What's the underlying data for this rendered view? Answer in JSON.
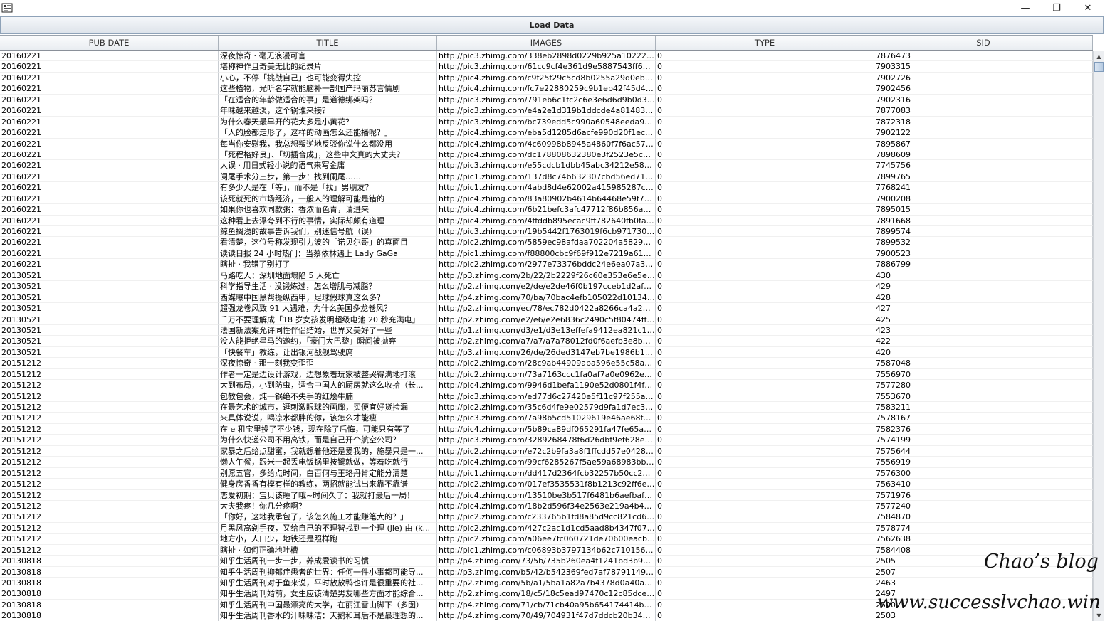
{
  "window": {
    "minimize": "—",
    "maximize": "❐",
    "close": "✕"
  },
  "toolbar": {
    "load_label": "Load Data"
  },
  "table": {
    "columns": [
      "PUB DATE",
      "TITLE",
      "IMAGES",
      "TYPE",
      "SID"
    ],
    "rows": [
      [
        "20160221",
        "深夜惊奇 · 毫无浪漫可言",
        "http://pic3.zhimg.com/338eb2898d0229b925a10222c1...",
        "0",
        "7876473"
      ],
      [
        "20160221",
        "堪称神作且奇美无比的纪录片",
        "http://pic3.zhimg.com/61cc9cf4e361d9e5887543ff6ab0...",
        "0",
        "7903315"
      ],
      [
        "20160221",
        "小心，不停「挑战自己」也可能变得失控",
        "http://pic4.zhimg.com/c9f25f29c5cd8b0255a29d0eb3dc...",
        "0",
        "7902726"
      ],
      [
        "20160221",
        "这些植物，光听名字就能脑补一部国产玛丽苏言情剧",
        "http://pic4.zhimg.com/fc7e22880259c9b1eb42f45d4b9b...",
        "0",
        "7902456"
      ],
      [
        "20160221",
        "「在适合的年龄做适合的事」是道德绑架吗？",
        "http://pic3.zhimg.com/791eb6c1fc2c6e3e6d6d9b0d392...",
        "0",
        "7902316"
      ],
      [
        "20160221",
        "年味越来越淡，这个锅谁来接？",
        "http://pic3.zhimg.com/e4a2e1d319b1ddcde4a81483f4a...",
        "0",
        "7877083"
      ],
      [
        "20160221",
        "为什么春天最早开的花大多是小黄花？",
        "http://pic3.zhimg.com/bc739edd5c990a60548eeda9d7...",
        "0",
        "7872318"
      ],
      [
        "20160221",
        "「人的脸都走形了，这样的动画怎么还能播呢？」",
        "http://pic4.zhimg.com/eba5d1285d6acfe990d20f1ec9b7...",
        "0",
        "7902122"
      ],
      [
        "20160221",
        "每当你安慰我，我总想叛逆地反驳你说什么都没用",
        "http://pic4.zhimg.com/4c60998b8945a4860f7f6ac57c89...",
        "0",
        "7895867"
      ],
      [
        "20160221",
        "「死程格好良」、「切插合成」，这些中文真的大丈夫？",
        "http://pic4.zhimg.com/dc178808632380e3f2523e5cffaf7...",
        "0",
        "7898609"
      ],
      [
        "20160221",
        "大误 · 用日式轻小说的语气来写金庸",
        "http://pic3.zhimg.com/e55cdcb1dbb45abc34212e587b2...",
        "0",
        "7745756"
      ],
      [
        "20160221",
        "阑尾手术分三步，第一步：找到阑尾……",
        "http://pic1.zhimg.com/137d8c74b632307cbd56ed71b8...",
        "0",
        "7899765"
      ],
      [
        "20160221",
        "有多少人是在「等」，而不是「找」男朋友？",
        "http://pic1.zhimg.com/4abd8d4e62002a415985287c6b...",
        "0",
        "7768241"
      ],
      [
        "20160221",
        "该死就死的市场经济，一般人的理解可能是错的",
        "http://pic4.zhimg.com/83a80902b4614b64468e59f7a01...",
        "0",
        "7900208"
      ],
      [
        "20160221",
        "如果你也喜欢同款粥：香浓而色青，请进来",
        "http://pic4.zhimg.com/6b21befc3afc47712f86b856abe4...",
        "0",
        "7895015"
      ],
      [
        "20160221",
        "这种看上去浮夸到不行的事情，实际却颇有道理",
        "http://pic4.zhimg.com/4ffddb895ecac9ff782640fb0fa991...",
        "0",
        "7891668"
      ],
      [
        "20160221",
        "鲸鱼搁浅的故事告诉我们，别迷信号航（误）",
        "http://pic3.zhimg.com/19b5442f1763019f6cb971730ff68...",
        "0",
        "7899574"
      ],
      [
        "20160221",
        "看清楚，这位号称发现引力波的「诺贝尔哥」的真面目",
        "http://pic2.zhimg.com/5859ec98afdaa702204a58291b9...",
        "0",
        "7899532"
      ],
      [
        "20160221",
        "读读日报 24 小时热门：当蔡依林遇上 Lady GaGa",
        "http://pic1.zhimg.com/f88800cbc9f69f912e7219a6186b...",
        "0",
        "7900523"
      ],
      [
        "20160221",
        "瞎扯 · 我错了别打了",
        "http://pic2.zhimg.com/2977e73376bddc24e6ea07a301...",
        "0",
        "7886799"
      ],
      [
        "20130521",
        "马路吃人：深圳地面塌陷 5 人死亡",
        "http://p3.zhimg.com/2b/22/2b2229f26c60e353e6e5efb5...",
        "0",
        "430"
      ],
      [
        "20130521",
        "科学指导生活 · 没锻炼过，怎么增肌与减脂？",
        "http://p2.zhimg.com/e2/de/e2de46f0b197cceb1d2af0d5...",
        "0",
        "429"
      ],
      [
        "20130521",
        "西媒曝中国黑帮操纵西甲，足球假球真这么多？",
        "http://p4.zhimg.com/70/ba/70bac4efb105022d1013494...",
        "0",
        "428"
      ],
      [
        "20130521",
        "超强龙卷风致 91 人遇难，为什么美国多龙卷风？",
        "http://p2.zhimg.com/ec/78/ec782d0422a8266ca4a2d58...",
        "0",
        "427"
      ],
      [
        "20130521",
        "千万不要理解成「18 岁女孩发明超级电池 20 秒充满电」",
        "http://p2.zhimg.com/e2/e6/e2e6836c2490c5f80474ff030...",
        "0",
        "425"
      ],
      [
        "20130521",
        "法国新法案允许同性伴侣结婚，世界又美好了一些",
        "http://p1.zhimg.com/d3/e1/d3e13effefa9412ea821c183...",
        "0",
        "423"
      ],
      [
        "20130521",
        "没人能拒绝星马的邀约，「豪门大巴黎」瞬间被抛弃",
        "http://p2.zhimg.com/a7/a7/a7a78012fd0f6aefb3e8b7e2...",
        "0",
        "422"
      ],
      [
        "20130521",
        "「快餐车」教练，让出银河战舰驾驶席",
        "http://p3.zhimg.com/26/de/26ded3147eb7be1986b1e79...",
        "0",
        "420"
      ],
      [
        "20151212",
        "深夜惊奇 · 那一刻我变歪歪",
        "http://pic2.zhimg.com/28c9ab44909aba596e55c58a2e...",
        "0",
        "7587048"
      ],
      [
        "20151212",
        "作者一定是边设计游戏，边想象着玩家被整哭得满地打滚",
        "http://pic2.zhimg.com/73a7163ccc1fa0af7a0e0962e2e9...",
        "0",
        "7556970"
      ],
      [
        "20151212",
        "大到布局，小到防虫，适合中国人的厨房就这么收拾（长...",
        "http://pic4.zhimg.com/9946d1befa1190e52d0801f4f21c...",
        "0",
        "7577280"
      ],
      [
        "20151212",
        "包教包会，炖一锅绝不失手的红烩牛腩",
        "http://pic3.zhimg.com/ed77d6c27420e5f11c97f255a89e...",
        "0",
        "7553670"
      ],
      [
        "20151212",
        "在最艺术的城市，逛刺激眼球的画廊，买便宜好货捡漏",
        "http://pic2.zhimg.com/35c6d4fe9e02579d9fa1d7ec36b1...",
        "0",
        "7583211"
      ],
      [
        "20151212",
        "来具体说说，喝凉水都胖的你，该怎么才能瘦",
        "http://pic3.zhimg.com/7a98b5cd51029619e46ae68f869...",
        "0",
        "7578167"
      ],
      [
        "20151212",
        "在 e 租宝里投了不少钱，现在除了后悔，可能只有等了",
        "http://pic4.zhimg.com/5b89ca89df065291fa47fe65a77b...",
        "0",
        "7582376"
      ],
      [
        "20151212",
        "为什么快递公司不用高铁，而是自己开个航空公司？",
        "http://pic3.zhimg.com/3289268478f6d26dbf9ef628ed12...",
        "0",
        "7574199"
      ],
      [
        "20151212",
        "家暴之后给点甜蜜，我就想着他还是爱我的，施暴只是一...",
        "http://pic2.zhimg.com/e72c2b9fa3a8f1ffcdd57e0428ce7...",
        "0",
        "7575644"
      ],
      [
        "20151212",
        "懒人午餐，跟米一起丢电饭锅里按键就做，等着吃就行",
        "http://pic4.zhimg.com/99cf6285267f5ae59a68983bb4c0...",
        "0",
        "7556919"
      ],
      [
        "20151212",
        "别愿五官，多给点时间，白百何与王珞丹肯定能分清楚",
        "http://pic1.zhimg.com/dd417d2364fcb32257b50cc298d...",
        "0",
        "7576300"
      ],
      [
        "20151212",
        "健身房香香有模有样的教练，两招就能试出来靠不靠谱",
        "http://pic2.zhimg.com/017ef3535531f8b1213c92ff6e9aa...",
        "0",
        "7563410"
      ],
      [
        "20151212",
        "恋爱初期：宝贝该睡了哦~时间久了：我就打最后一局！",
        "http://pic4.zhimg.com/13510be3b517f6481b6aefbaf092...",
        "0",
        "7571976"
      ],
      [
        "20151212",
        "大夫我疼！你几分疼啊？",
        "http://pic4.zhimg.com/18b2d596f34e2563e219a4b456d...",
        "0",
        "7577240"
      ],
      [
        "20151212",
        "「你好，这地我承包了，该怎么施工才能赚笔大的？」",
        "http://pic2.zhimg.com/c233765b1fd8a85d9cc821cd6ecc...",
        "0",
        "7584870"
      ],
      [
        "20151212",
        "月黑风高剁手夜，又给自己的不理智找到一个理 (jie) 由 (k...",
        "http://pic2.zhimg.com/427c2ac1d1cd5aad8b4347f0771...",
        "0",
        "7578774"
      ],
      [
        "20151212",
        "地方小，人口少，地铁还是照样跑",
        "http://pic2.zhimg.com/a06ee7fc060721de70600eacb44f...",
        "0",
        "7562638"
      ],
      [
        "20151212",
        "瞎扯 · 如何正确地吐槽",
        "http://pic1.zhimg.com/c06893b3797134b62c710156ab...",
        "0",
        "7584408"
      ],
      [
        "20130818",
        "知乎生活周刊一步一步，养成爱读书的习惯",
        "http://p4.zhimg.com/73/5b/735b260ea4f1241bd3b9246...",
        "0",
        "2505"
      ],
      [
        "20130818",
        "知乎生活周刊抑郁症患者的世界：任何一件小事都可能导...",
        "http://p3.zhimg.com/b5/42/b542369fed7af78791149b19...",
        "0",
        "2507"
      ],
      [
        "20130818",
        "知乎生活周刊对于鱼来说，平时放放鸭也许是很重要的社...",
        "http://p2.zhimg.com/5b/a1/5ba1a82a7b4378d0a40a575...",
        "0",
        "2463"
      ],
      [
        "20130818",
        "知乎生活周刊婚前，女生应该清楚男友哪些方面才能综合...",
        "http://p2.zhimg.com/18/c5/18c5ead97470c12c85dce26...",
        "0",
        "2497"
      ],
      [
        "20130818",
        "知乎生活周刊中国最漂亮的大学，在丽江雪山脚下（多图）",
        "http://p4.zhimg.com/71/cb/71cb40a95b654174414bb27...",
        "0",
        "2500"
      ],
      [
        "20130818",
        "知乎生活周刊香水的汗味味洁：天鹅和耳后不是最理想的...",
        "http://p4.zhimg.com/70/49/704931f47d7ddcb20b34209...",
        "0",
        "2503"
      ]
    ]
  },
  "watermark": {
    "line1": "Chao’s blog",
    "line2": "www.successlvchao.win"
  }
}
